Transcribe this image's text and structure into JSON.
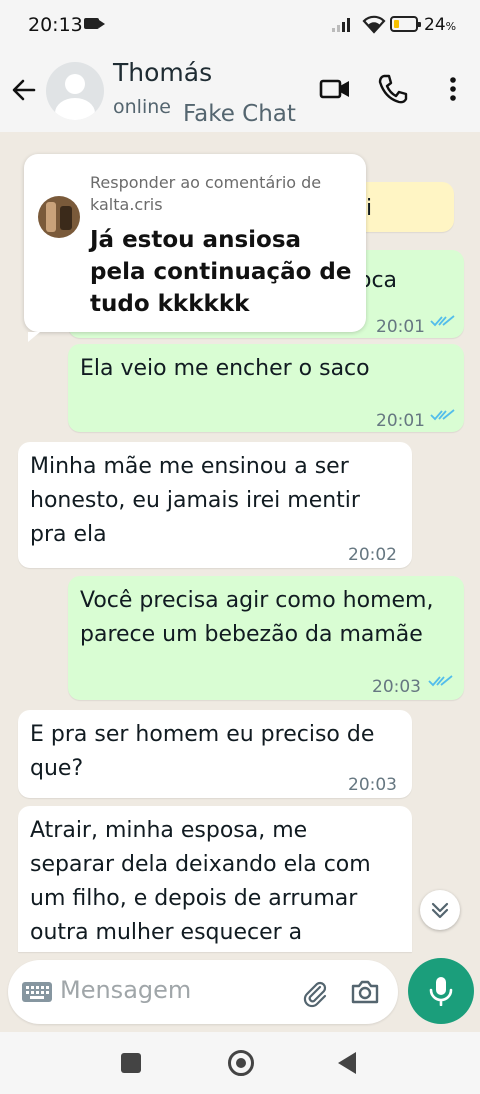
{
  "status_bar": {
    "time": "20:13",
    "battery": "24",
    "battery_unit": "%",
    "battery_level": 0.24
  },
  "header": {
    "contact_name": "Thomás",
    "presence": "online",
    "overlay_label": "Fake Chat"
  },
  "reply_sticker": {
    "title": "Responder ao comentário de kalta.cris",
    "comment": "Já estou ansiosa pela continuação de tudo kkkkkk"
  },
  "messages": [
    {
      "direction": "in",
      "text": "i",
      "time": ""
    },
    {
      "direction": "out",
      "text": "oca",
      "time": "20:01"
    },
    {
      "direction": "out",
      "text": "Ela veio me encher o saco",
      "time": "20:01"
    },
    {
      "direction": "in",
      "text": "Minha mãe me ensinou a ser honesto, eu jamais irei mentir pra ela",
      "time": "20:02"
    },
    {
      "direction": "out",
      "text": "Você precisa agir como homem, parece um bebezão da mamãe",
      "time": "20:03"
    },
    {
      "direction": "in",
      "text": "E pra ser homem eu preciso de que?",
      "time": "20:03"
    },
    {
      "direction": "in",
      "text": "Atrair, minha esposa, me separar dela deixando ela com um filho, e depois de arrumar outra mulher esquecer a",
      "time": ""
    }
  ],
  "composer": {
    "placeholder": "Mensagem"
  },
  "colors": {
    "accent": "#1b9e7b",
    "outgoing": "#d9fdd3",
    "incoming": "#ffffff",
    "tick": "#53bdeb"
  }
}
